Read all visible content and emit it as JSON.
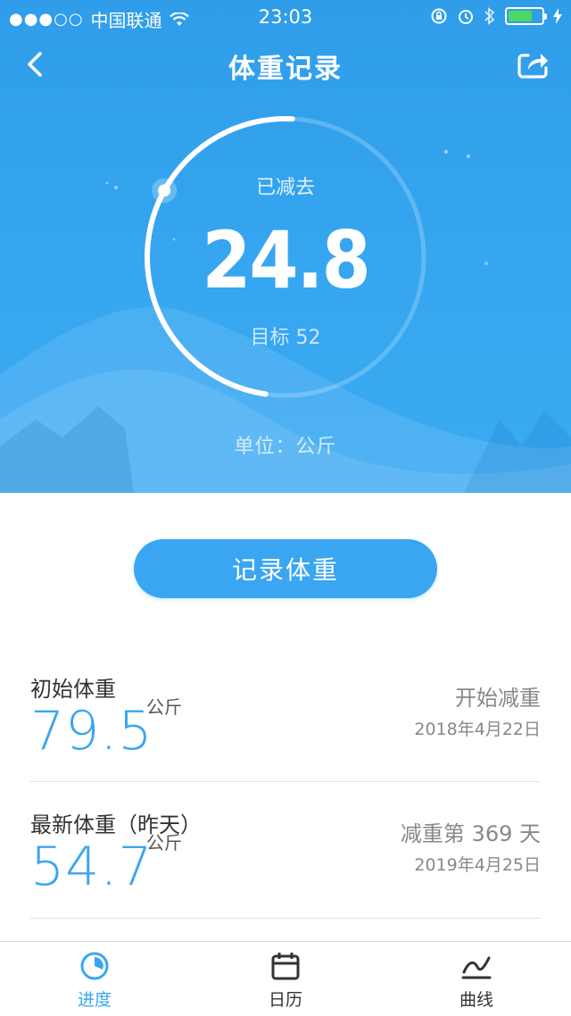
{
  "status_bar": {
    "signal": "●●●○○",
    "carrier": "中国联通",
    "time": "23:03"
  },
  "nav": {
    "title": "体重记录",
    "back_icon": "chevron-left-icon",
    "share_icon": "share-icon"
  },
  "progress": {
    "label": "已减去",
    "value": "24.8",
    "target": "目标 52",
    "fraction": 0.477,
    "unit": "单位：公斤"
  },
  "record_button": {
    "label": "记录体重"
  },
  "stats": [
    {
      "label": "初始体重",
      "value": "79.5",
      "unit": "公斤",
      "right_title": "开始减重",
      "right_sub": "2018年4月22日"
    },
    {
      "label": "最新体重（昨天）",
      "value": "54.7",
      "unit": "公斤",
      "right_title": "减重第 369 天",
      "right_sub": "2019年4月25日"
    }
  ],
  "tabs": [
    {
      "label": "进度",
      "icon": "progress-pie-icon",
      "active": true
    },
    {
      "label": "日历",
      "icon": "calendar-icon",
      "active": false
    },
    {
      "label": "曲线",
      "icon": "line-chart-icon",
      "active": false
    }
  ],
  "colors": {
    "primary": "#3aa6f1",
    "hero_top": "#2f9de9",
    "battery": "#4cd964"
  }
}
